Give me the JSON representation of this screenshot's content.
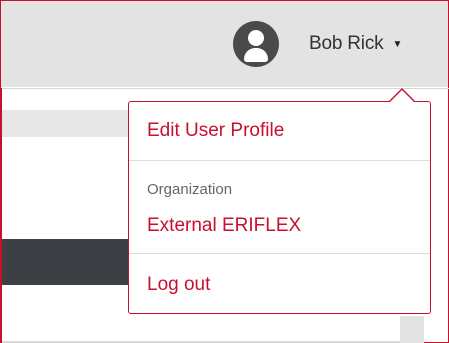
{
  "header": {
    "user_name": "Bob Rick",
    "caret": "▼"
  },
  "dropdown": {
    "edit_profile_label": "Edit User Profile",
    "organization_label": "Organization",
    "organization_name": "External ERIFLEX",
    "logout_label": "Log out"
  },
  "colors": {
    "accent": "#c8102e",
    "topbar": "#e3e3e3",
    "avatar": "#4a4a4a"
  },
  "icons": {
    "avatar": "user-avatar-icon",
    "caret": "caret-down-icon"
  }
}
